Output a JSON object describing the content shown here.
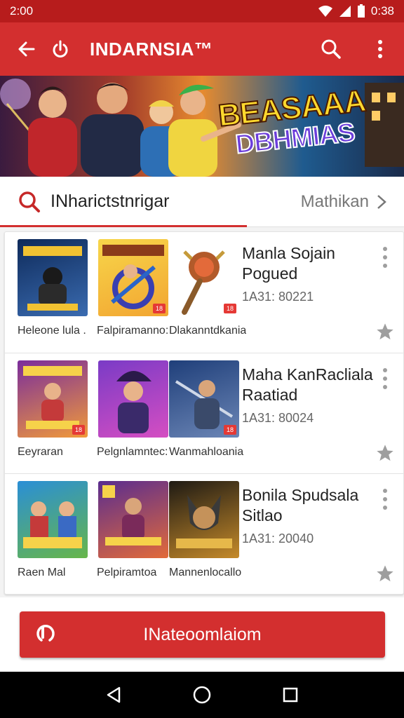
{
  "status_bar": {
    "time_left": "2:00",
    "time_right": "0:38"
  },
  "app_bar": {
    "title": "INDARNSIA™"
  },
  "banner": {
    "line1": "BEASAAA",
    "line2": "DBHMIAS"
  },
  "search": {
    "query": "INharictstnrigar",
    "more_label": "Mathikan"
  },
  "rows": [
    {
      "title": "Manla Sojain Pogued",
      "meta": "1A31:  80221",
      "thumbs": [
        {
          "label": "Heleone lula .",
          "colors": [
            "#0e2a5a",
            "#3a6bb0"
          ]
        },
        {
          "label": "Falpiramanno:",
          "colors": [
            "#f7d64a",
            "#f2a531"
          ]
        },
        {
          "label": "Dlakanntdkania",
          "colors": [
            "#ffffff",
            "#f2f2f2"
          ]
        }
      ]
    },
    {
      "title": "Maha KanRacliala Raatiad",
      "meta": "1A31:  80024",
      "thumbs": [
        {
          "label": "Eeyraran",
          "colors": [
            "#7a2d9c",
            "#f19a3a"
          ]
        },
        {
          "label": "Pelgnlamntec:",
          "colors": [
            "#7a3bc6",
            "#d54ec2"
          ]
        },
        {
          "label": "Wanmahloania",
          "colors": [
            "#1f3f7a",
            "#6c86b6"
          ]
        }
      ]
    },
    {
      "title": "Bonila Spudsala Sitlao",
      "meta": "1A31:  20040",
      "thumbs": [
        {
          "label": "Raen Mal",
          "colors": [
            "#2a8fd6",
            "#67b64a"
          ]
        },
        {
          "label": "Pelpiramtoa",
          "colors": [
            "#5a2d8f",
            "#e26a3a"
          ]
        },
        {
          "label": "Mannenlocallo",
          "colors": [
            "#1e1a14",
            "#c58a2a"
          ]
        }
      ]
    }
  ],
  "install_button": {
    "label": "INateoomlaiom"
  },
  "colors": {
    "primary": "#d32f2f",
    "status": "#b71c1c"
  },
  "icons": [
    "back-arrow-icon",
    "power-icon",
    "search-icon",
    "more-vert-icon",
    "star-icon",
    "nav-back-icon",
    "nav-home-icon",
    "nav-recents-icon"
  ]
}
